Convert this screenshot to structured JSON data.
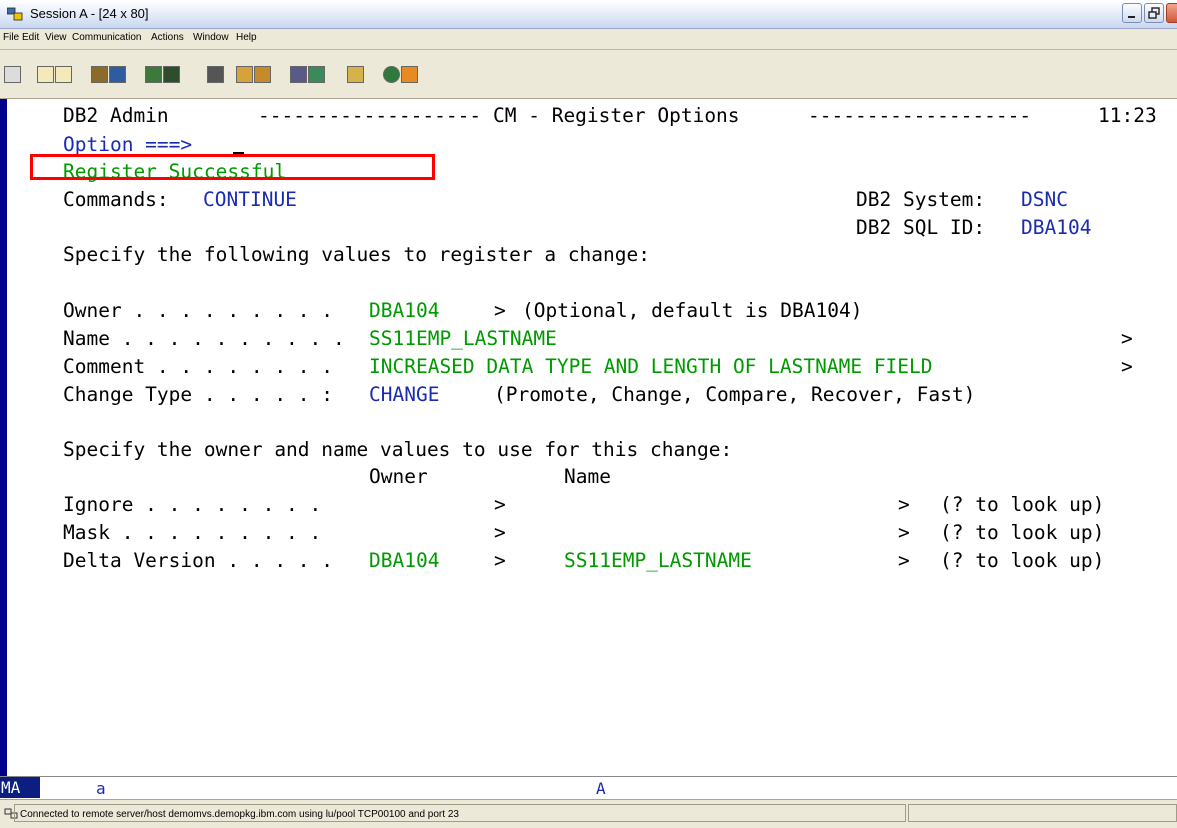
{
  "window": {
    "title": "Session A - [24 x 80]"
  },
  "menu": [
    "File",
    "Edit",
    "View",
    "Communication",
    "Actions",
    "Window",
    "Help"
  ],
  "screen": {
    "header_left": "DB2 Admin",
    "header_dashes1": "-------------------",
    "header_title": "CM - Register Options",
    "header_dashes2": "-------------------",
    "header_time": "11:23",
    "option_label": "Option ===>",
    "message": "Register Successful",
    "commands_label": "Commands:",
    "commands_value": "CONTINUE",
    "db2_system_label": "DB2 System:",
    "db2_system_value": "DSNC",
    "db2_sqlid_label": "DB2 SQL ID:",
    "db2_sqlid_value": "DBA104",
    "instruction1": "Specify the following values to register a change:",
    "owner_label": "Owner . . . . . . . . .",
    "owner_value": "DBA104",
    "owner_arrow": ">",
    "owner_note": "(Optional, default is DBA104)",
    "name_label": "Name . . . . . . . . . .",
    "name_value": "SS11EMP_LASTNAME",
    "name_arrow": ">",
    "comment_label": "Comment . . . . . . . .",
    "comment_value": "INCREASED DATA TYPE AND LENGTH OF LASTNAME FIELD",
    "comment_arrow": ">",
    "changetype_label": "Change Type . . . . . :",
    "changetype_value": "CHANGE",
    "changetype_note": "(Promote, Change, Compare, Recover, Fast)",
    "instruction2": "Specify the owner and name values to use for this change:",
    "col_owner": "Owner",
    "col_name": "Name",
    "ignore_label": "Ignore . . . . . . . .",
    "mask_label": "Mask . . . . . . . . .",
    "delta_label": "Delta Version . . . . .",
    "delta_owner": "DBA104",
    "delta_name": "SS11EMP_LASTNAME",
    "arrow": ">",
    "lookup_note": "(? to look up)"
  },
  "oia": {
    "ma": "MA",
    "a1": "a",
    "a2": "A"
  },
  "status": {
    "text": "Connected to remote server/host demomvs.demopkg.ibm.com using lu/pool TCP00100 and port 23"
  },
  "colors": {
    "field_green": "#009a00",
    "label_navy": "#1a2bb0",
    "highlight": "#ff0000"
  },
  "toolbar_icons": [
    "display-icon",
    "copy-icon",
    "paste-icon",
    "send-icon",
    "receive-icon",
    "macro-play-icon",
    "macro-record-icon",
    "print-icon",
    "color-icon",
    "keyboard-icon",
    "transfer-icon",
    "transfer-2-icon",
    "clipboard-icon",
    "globe-icon",
    "edit-icon"
  ]
}
